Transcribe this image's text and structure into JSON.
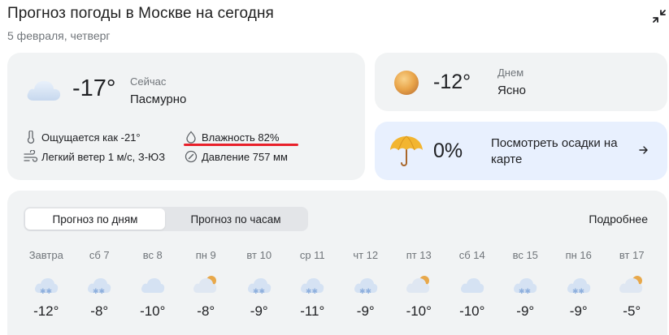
{
  "header": {
    "title": "Прогноз погоды в Москве на сегодня",
    "date": "5 февраля, четверг"
  },
  "now": {
    "temp": "-17°",
    "label": "Сейчас",
    "condition": "Пасмурно",
    "feels_like": "Ощущается как -21°",
    "humidity": "Влажность 82%",
    "wind": "Легкий ветер 1 м/с, З-ЮЗ",
    "pressure": "Давление 757 мм",
    "icon": "cloud-icon"
  },
  "day": {
    "temp": "-12°",
    "label": "Днем",
    "condition": "Ясно",
    "icon": "sun-icon"
  },
  "precip": {
    "value": "0%",
    "text": "Посмотреть осадки на карте",
    "icon": "umbrella-icon"
  },
  "forecast": {
    "tab_days": "Прогноз по дням",
    "tab_hours": "Прогноз по часам",
    "more": "Подробнее",
    "days": [
      {
        "name": "Завтра",
        "temp": "-12°",
        "icon": "snow-cloud"
      },
      {
        "name": "сб 7",
        "temp": "-8°",
        "icon": "snow-cloud"
      },
      {
        "name": "вс 8",
        "temp": "-10°",
        "icon": "cloud"
      },
      {
        "name": "пн 9",
        "temp": "-8°",
        "icon": "sun-cloud"
      },
      {
        "name": "вт 10",
        "temp": "-9°",
        "icon": "snow-cloud"
      },
      {
        "name": "ср 11",
        "temp": "-11°",
        "icon": "snow-cloud"
      },
      {
        "name": "чт 12",
        "temp": "-9°",
        "icon": "snow-cloud"
      },
      {
        "name": "пт 13",
        "temp": "-10°",
        "icon": "sun-cloud"
      },
      {
        "name": "сб 14",
        "temp": "-10°",
        "icon": "cloud"
      },
      {
        "name": "вс 15",
        "temp": "-9°",
        "icon": "snow-cloud"
      },
      {
        "name": "пн 16",
        "temp": "-9°",
        "icon": "snow-cloud"
      },
      {
        "name": "вт 17",
        "temp": "-5°",
        "icon": "sun-cloud"
      }
    ]
  },
  "colors": {
    "highlight_underline": "#e8202a",
    "precip_card": "#e8f0fe",
    "card_bg": "#f1f3f4"
  }
}
